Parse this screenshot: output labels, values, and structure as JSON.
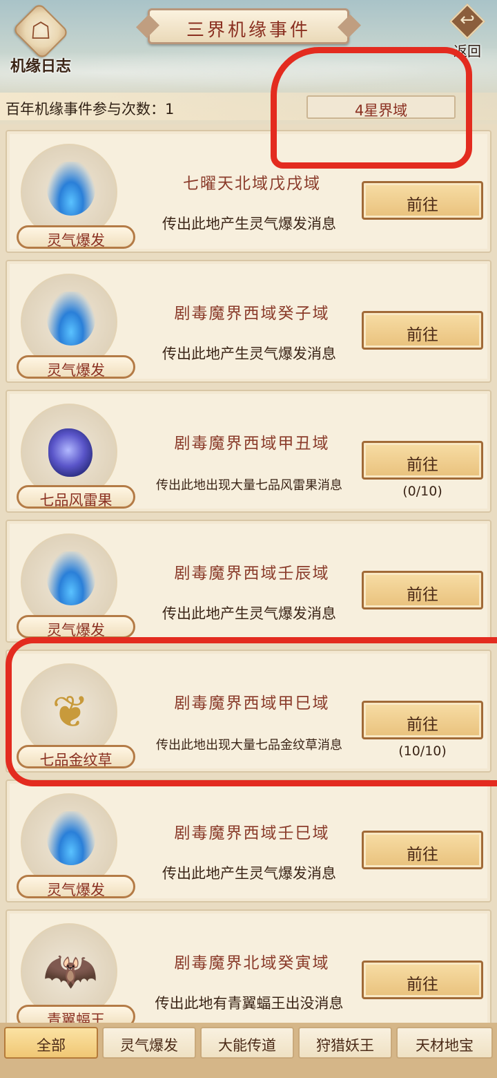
{
  "header": {
    "log_label": "机缘日志",
    "title": "三界机缘事件",
    "back_label": "返回",
    "participation": "百年机缘事件参与次数：1",
    "realm": "4星界域"
  },
  "events": [
    {
      "tag": "灵气爆发",
      "icon": "spirit-burst",
      "title": "七曜天北域戊戌域",
      "desc": "传出此地产生灵气爆发消息",
      "button": "前往",
      "progress": ""
    },
    {
      "tag": "灵气爆发",
      "icon": "spirit-burst",
      "title": "剧毒魔界西域癸子域",
      "desc": "传出此地产生灵气爆发消息",
      "button": "前往",
      "progress": ""
    },
    {
      "tag": "七品风雷果",
      "icon": "thunder-fruit",
      "title": "剧毒魔界西域甲丑域",
      "desc": "传出此地出现大量七品风雷果消息",
      "button": "前往",
      "progress": "(0/10)"
    },
    {
      "tag": "灵气爆发",
      "icon": "spirit-burst",
      "title": "剧毒魔界西域壬辰域",
      "desc": "传出此地产生灵气爆发消息",
      "button": "前往",
      "progress": ""
    },
    {
      "tag": "七品金纹草",
      "icon": "gold-herb",
      "title": "剧毒魔界西域甲巳域",
      "desc": "传出此地出现大量七品金纹草消息",
      "button": "前往",
      "progress": "(10/10)"
    },
    {
      "tag": "灵气爆发",
      "icon": "spirit-burst",
      "title": "剧毒魔界西域壬巳域",
      "desc": "传出此地产生灵气爆发消息",
      "button": "前往",
      "progress": ""
    },
    {
      "tag": "青翼蝠王",
      "icon": "bat-king",
      "title": "剧毒魔界北域癸寅域",
      "desc": "传出此地有青翼蝠王出没消息",
      "button": "前往",
      "progress": ""
    }
  ],
  "tabs": [
    {
      "label": "全部",
      "active": true
    },
    {
      "label": "灵气爆发",
      "active": false
    },
    {
      "label": "大能传道",
      "active": false
    },
    {
      "label": "狩猎妖王",
      "active": false
    },
    {
      "label": "天材地宝",
      "active": false
    }
  ],
  "colors": {
    "accent": "#8a2f20",
    "annotation": "#e32b1f",
    "button": "#e9c17c"
  }
}
